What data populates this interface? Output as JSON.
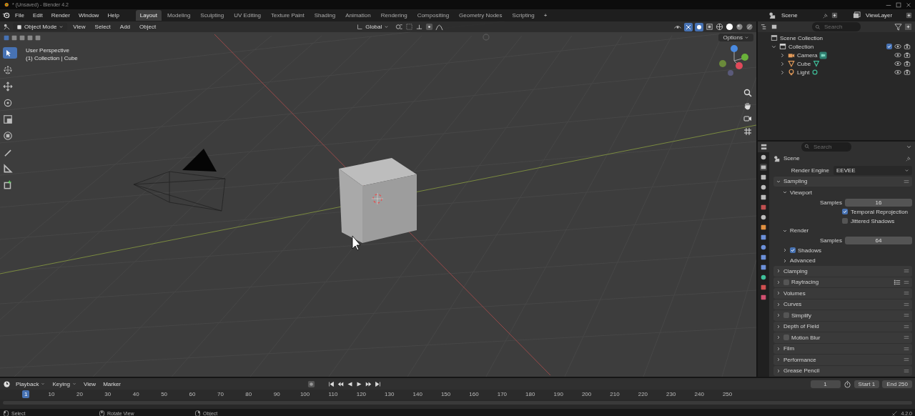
{
  "title_bar": {
    "title": "* (Unsaved) - Blender 4.2"
  },
  "menu": [
    "File",
    "Edit",
    "Render",
    "Window",
    "Help"
  ],
  "workspaces": [
    {
      "label": "Layout",
      "selected": true
    },
    {
      "label": "Modeling",
      "selected": false
    },
    {
      "label": "Sculpting",
      "selected": false
    },
    {
      "label": "UV Editing",
      "selected": false
    },
    {
      "label": "Texture Paint",
      "selected": false
    },
    {
      "label": "Shading",
      "selected": false
    },
    {
      "label": "Animation",
      "selected": false
    },
    {
      "label": "Rendering",
      "selected": false
    },
    {
      "label": "Compositing",
      "selected": false
    },
    {
      "label": "Geometry Nodes",
      "selected": false
    },
    {
      "label": "Scripting",
      "selected": false
    }
  ],
  "add_workspace": "+",
  "scene": "Scene",
  "view_layer": "ViewLayer",
  "viewport": {
    "mode": "Object Mode",
    "menus": [
      "View",
      "Select",
      "Add",
      "Object"
    ],
    "orientation": "Global",
    "options": "Options",
    "overlay_text": [
      "User Perspective",
      "(1) Collection | Cube"
    ]
  },
  "outliner": {
    "search": {
      "placeholder": "Search"
    },
    "tree": [
      {
        "label": "Scene Collection",
        "kind": "scene_collection",
        "children": [
          {
            "label": "Collection",
            "kind": "collection",
            "expanded": true,
            "checked": true,
            "children": [
              {
                "label": "Camera",
                "kind": "camera",
                "expanded": false
              },
              {
                "label": "Cube",
                "kind": "mesh",
                "expanded": false
              },
              {
                "label": "Light",
                "kind": "light",
                "expanded": false
              }
            ]
          }
        ]
      }
    ]
  },
  "properties": {
    "search": {
      "placeholder": "Search"
    },
    "context": "Scene",
    "render_engine": {
      "label": "Render Engine",
      "value": "EEVEE"
    },
    "panels": [
      {
        "kind": "panel",
        "label": "Sampling",
        "expanded": true,
        "children": [
          {
            "kind": "panel",
            "label": "Viewport",
            "expanded": true,
            "children": [
              {
                "kind": "number",
                "label": "Samples",
                "value": "16"
              },
              {
                "kind": "checkbox",
                "label": "Temporal Reprojection",
                "checked": true
              },
              {
                "kind": "checkbox",
                "label": "Jittered Shadows",
                "checked": false
              }
            ]
          },
          {
            "kind": "panel",
            "label": "Render",
            "expanded": true,
            "children": [
              {
                "kind": "number",
                "label": "Samples",
                "value": "64"
              }
            ]
          },
          {
            "kind": "panel",
            "label": "Shadows",
            "expanded": false,
            "checked": true
          },
          {
            "kind": "panel",
            "label": "Advanced",
            "expanded": false
          }
        ]
      },
      {
        "kind": "panel",
        "label": "Clamping",
        "expanded": false
      },
      {
        "kind": "panel",
        "label": "Raytracing",
        "expanded": false,
        "checked": false,
        "presets": true
      },
      {
        "kind": "panel",
        "label": "Volumes",
        "expanded": false
      },
      {
        "kind": "panel",
        "label": "Curves",
        "expanded": false
      },
      {
        "kind": "panel",
        "label": "Simplify",
        "expanded": false,
        "checked": false
      },
      {
        "kind": "panel",
        "label": "Depth of Field",
        "expanded": false
      },
      {
        "kind": "panel",
        "label": "Motion Blur",
        "expanded": false,
        "checked": false
      },
      {
        "kind": "panel",
        "label": "Film",
        "expanded": false
      },
      {
        "kind": "panel",
        "label": "Performance",
        "expanded": false
      },
      {
        "kind": "panel",
        "label": "Grease Pencil",
        "expanded": false
      }
    ]
  },
  "timeline": {
    "menus": [
      "Playback",
      "Keying",
      "View",
      "Marker"
    ],
    "current_frame": "1",
    "start": {
      "label": "Start",
      "value": "1"
    },
    "end": {
      "label": "End",
      "value": "250"
    },
    "playhead": "1",
    "ticks": [
      "10",
      "20",
      "30",
      "40",
      "50",
      "60",
      "70",
      "80",
      "90",
      "100",
      "110",
      "120",
      "130",
      "140",
      "150",
      "160",
      "170",
      "180",
      "190",
      "200",
      "210",
      "220",
      "230",
      "240",
      "250"
    ]
  },
  "status_bar": {
    "items": [
      {
        "kind": "left",
        "label": "Select"
      },
      {
        "kind": "middle",
        "label": "Rotate View"
      },
      {
        "kind": "right",
        "label": "Object"
      }
    ],
    "version": "4.2.0"
  }
}
